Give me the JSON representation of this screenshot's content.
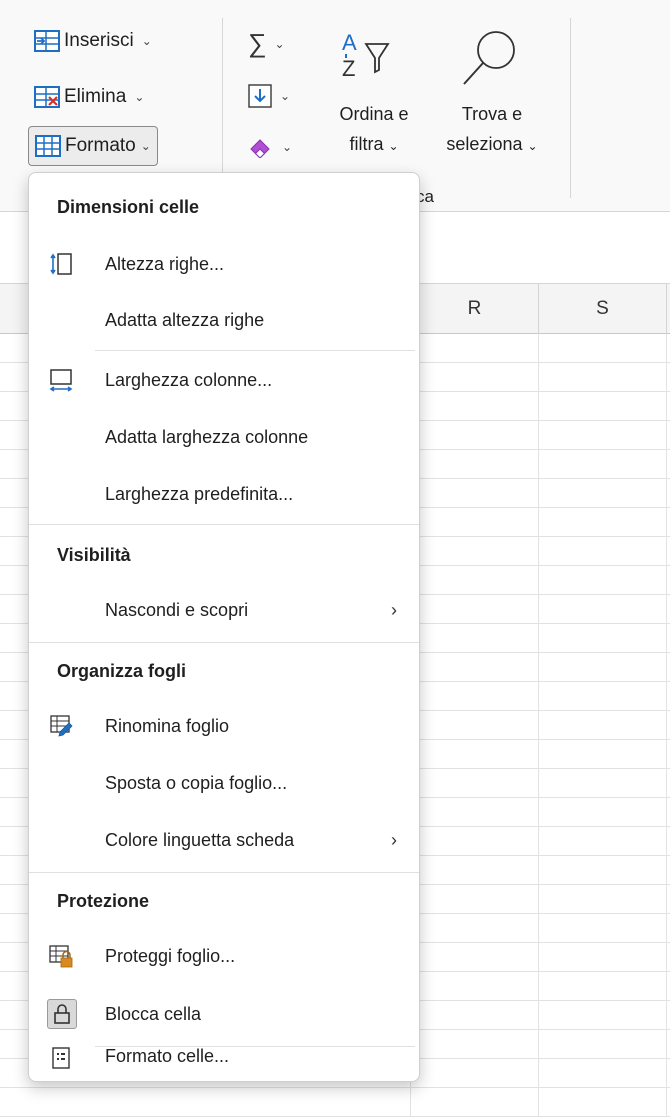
{
  "ribbon": {
    "insert_label": "Inserisci",
    "delete_label": "Elimina",
    "format_label": "Formato",
    "sort_line1": "Ordina e",
    "sort_line2": "filtra",
    "find_line1": "Trova e",
    "find_line2": "seleziona",
    "group_label_partial": "ca"
  },
  "columns": [
    "R",
    "S"
  ],
  "menu": {
    "sections": {
      "dimensions": "Dimensioni celle",
      "visibility": "Visibilità",
      "organize": "Organizza fogli",
      "protection": "Protezione"
    },
    "items": {
      "row_height": "Altezza righe...",
      "autofit_row": "Adatta altezza righe",
      "col_width": "Larghezza colonne...",
      "autofit_col": "Adatta larghezza colonne",
      "default_width": "Larghezza predefinita...",
      "hide_unhide": "Nascondi e scopri",
      "rename_sheet": "Rinomina foglio",
      "move_copy": "Sposta o copia foglio...",
      "tab_color": "Colore linguetta scheda",
      "protect_sheet": "Proteggi foglio...",
      "lock_cell": "Blocca cella",
      "format_cells": "Formato celle..."
    }
  },
  "colors": {
    "accent_blue": "#1e6fc4",
    "eraser_purple": "#b14fd4",
    "lock_orange": "#d98a1e"
  }
}
